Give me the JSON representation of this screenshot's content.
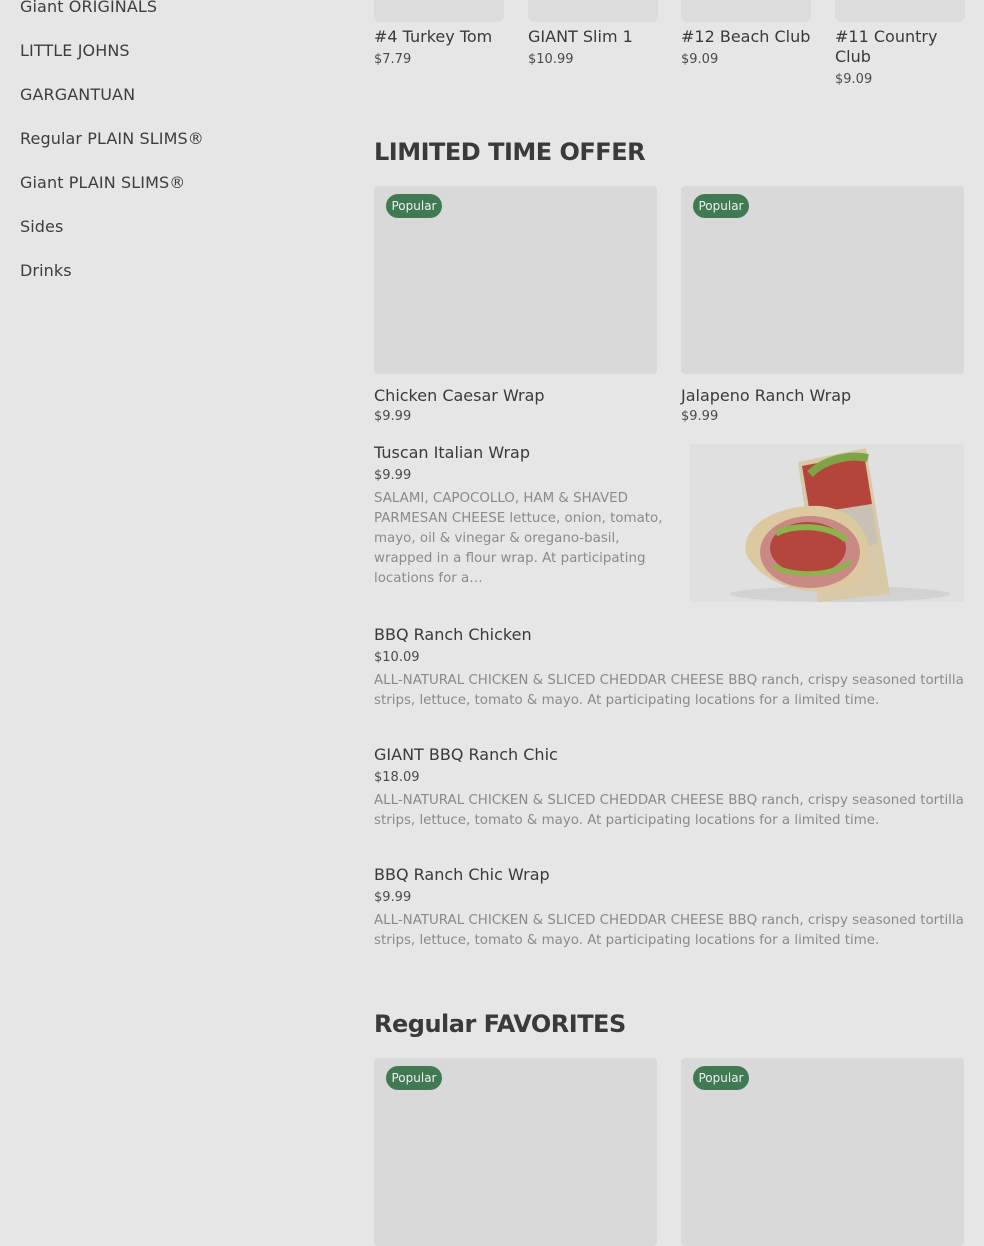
{
  "sidebar": {
    "items": [
      {
        "label": "Giant ORIGINALS"
      },
      {
        "label": "LITTLE JOHNS"
      },
      {
        "label": "GARGANTUAN"
      },
      {
        "label": "Regular PLAIN SLIMS®"
      },
      {
        "label": "Giant PLAIN SLIMS®"
      },
      {
        "label": "Sides"
      },
      {
        "label": "Drinks"
      }
    ]
  },
  "top_row": [
    {
      "name": "#4 Turkey Tom",
      "price": "$7.79"
    },
    {
      "name": "GIANT Slim 1",
      "price": "$10.99"
    },
    {
      "name": "#12 Beach Club",
      "price": "$9.09"
    },
    {
      "name": "#11 Country Club",
      "price": "$9.09"
    }
  ],
  "limited": {
    "title": "LIMITED TIME OFFER",
    "badge": "Popular",
    "cards": [
      {
        "name": "Chicken Caesar Wrap",
        "price": "$9.99"
      },
      {
        "name": "Jalapeno Ranch Wrap",
        "price": "$9.99"
      }
    ],
    "list": [
      {
        "name": "Tuscan Italian Wrap",
        "price": "$9.99",
        "desc": "SALAMI, CAPOCOLLO, HAM & SHAVED PARMESAN CHEESE lettuce, onion, tomato, mayo, oil & vinegar & oregano-basil, wrapped in a flour wrap. At participating locations for a…"
      },
      {
        "name": "BBQ Ranch Chicken",
        "price": "$10.09",
        "desc": "ALL-NATURAL CHICKEN & SLICED CHEDDAR CHEESE BBQ ranch, crispy seasoned tortilla strips, lettuce, tomato & mayo. At participating locations for a limited time."
      },
      {
        "name": "GIANT BBQ Ranch Chic",
        "price": "$18.09",
        "desc": "ALL-NATURAL CHICKEN & SLICED CHEDDAR CHEESE BBQ ranch, crispy seasoned tortilla strips, lettuce, tomato & mayo. At participating locations for a limited time."
      },
      {
        "name": "BBQ Ranch Chic Wrap",
        "price": "$9.99",
        "desc": "ALL-NATURAL CHICKEN & SLICED CHEDDAR CHEESE BBQ ranch, crispy seasoned tortilla strips, lettuce, tomato & mayo. At participating locations for a limited time."
      }
    ]
  },
  "favorites": {
    "title": "Regular FAVORITES",
    "badge": "Popular"
  },
  "colors": {
    "background": "#e6e6e6",
    "badge": "#3f7a53",
    "text": "#3a3a3a",
    "desc": "#8a8a8a"
  }
}
